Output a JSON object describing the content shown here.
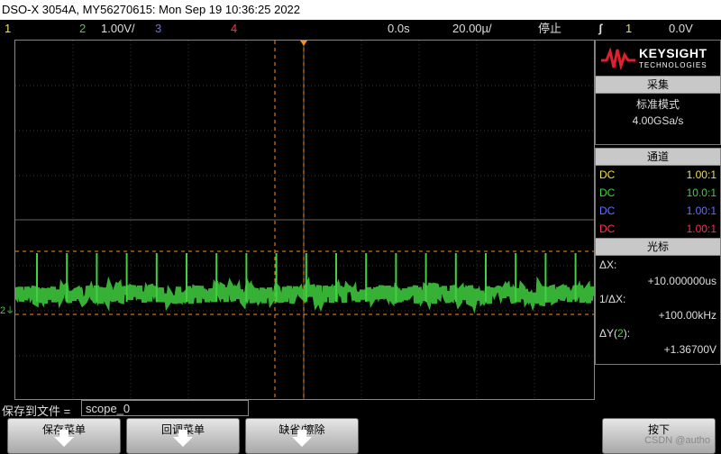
{
  "title": "DSO-X 3054A, MY56270615: Mon Sep 19 10:36:25 2022",
  "status": {
    "ch1": "1",
    "ch2": "2",
    "ch2_scale": "1.00V/",
    "ch3": "3",
    "ch4": "4",
    "time_offset": "0.0s",
    "time_scale": "20.00µ/",
    "run_state": "停止",
    "trigger_icon": "trigger-edge-icon",
    "trigger_source": "1",
    "trigger_level": "0.0V"
  },
  "logo": {
    "brand": "KEYSIGHT",
    "sub": "TECHNOLOGIES"
  },
  "acquire": {
    "header": "采集",
    "mode": "标准模式",
    "rate": "4.00GSa/s"
  },
  "channels": {
    "header": "通道",
    "rows": [
      {
        "coupling": "DC",
        "ratio": "1.00:1",
        "color": "#f0e040"
      },
      {
        "coupling": "DC",
        "ratio": "10.0:1",
        "color": "#40d040"
      },
      {
        "coupling": "DC",
        "ratio": "1.00:1",
        "color": "#6070ff"
      },
      {
        "coupling": "DC",
        "ratio": "1.00:1",
        "color": "#ff3050"
      }
    ]
  },
  "cursors": {
    "header": "光标",
    "dx_label": "ΔX:",
    "dx_value": "+10.000000us",
    "inv_dx_label": "1/ΔX:",
    "inv_dx_value": "+100.00kHz",
    "dy_label_pre": "ΔY(",
    "dy_label_ch": "2",
    "dy_label_post": "):",
    "dy_value": "+1.36700V"
  },
  "file": {
    "label": "保存到文件 =",
    "value": "scope_0"
  },
  "softkeys": {
    "save_menu": "保存菜单",
    "recall_menu": "回调菜单",
    "defaults": "缺省/擦除",
    "press": "按下"
  },
  "watermark": "CSDN @autho",
  "colors": {
    "ch1": "#f0e040",
    "ch2": "#40d040",
    "ch3": "#6070ff",
    "ch4": "#ff3050",
    "cursor": "#ff8c1a"
  }
}
